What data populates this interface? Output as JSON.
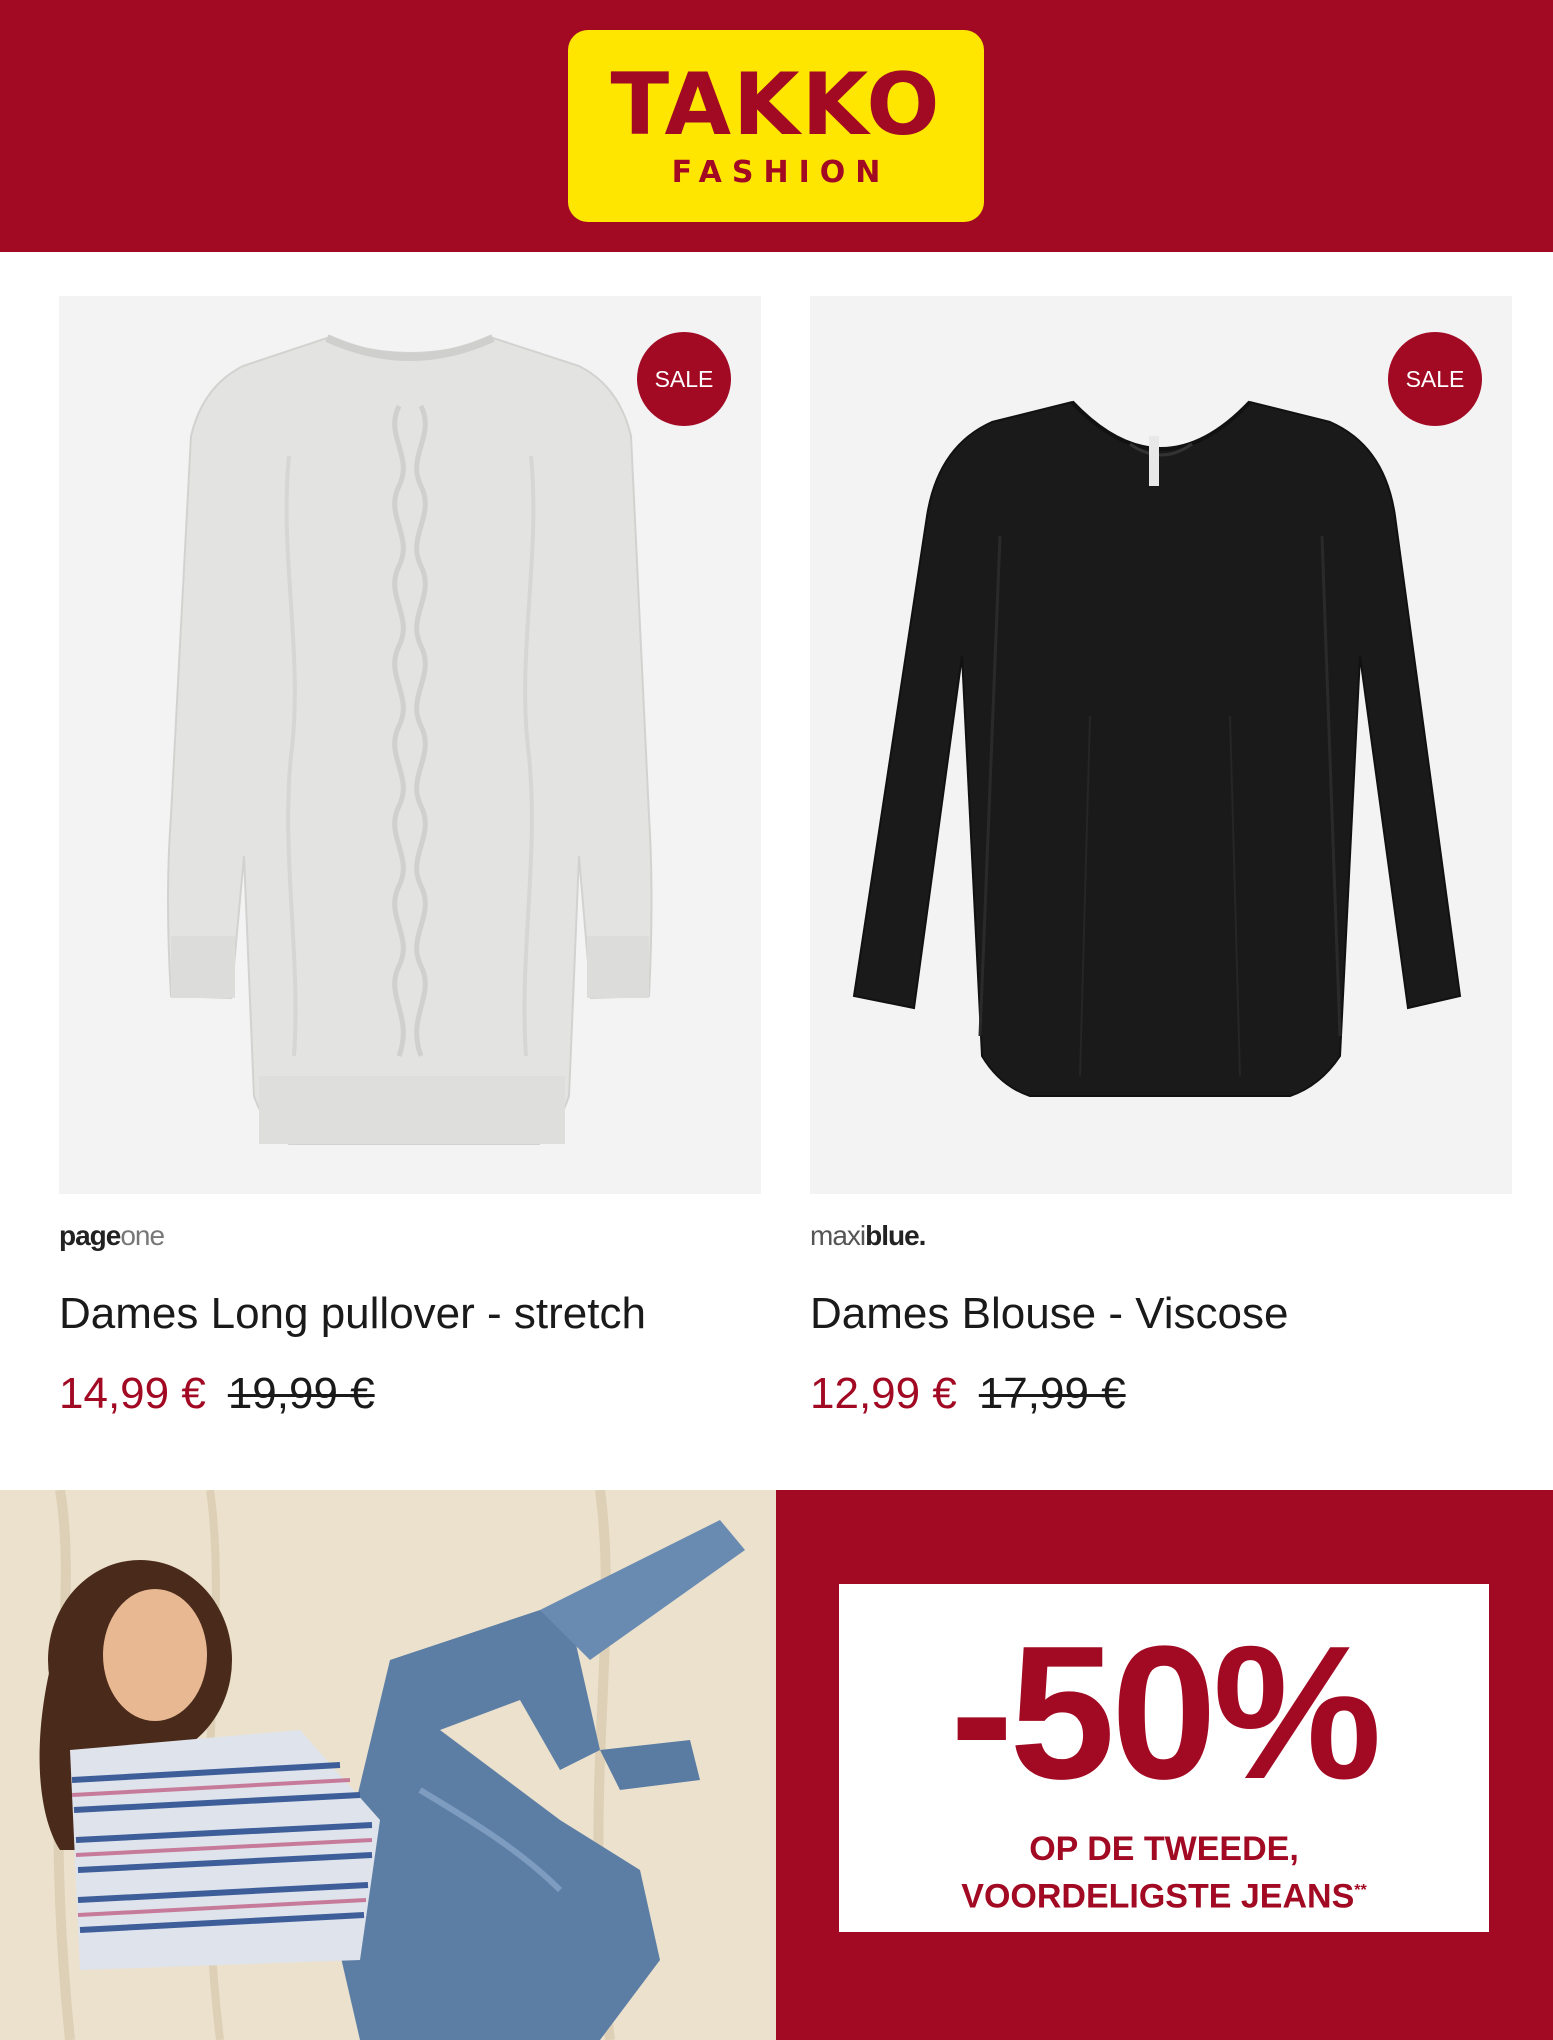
{
  "header": {
    "logo_word": "TAKKO",
    "logo_sub": "FASHION",
    "brand_color": "#a20a24",
    "logo_color": "#ffe600"
  },
  "products": [
    {
      "badge": "SALE",
      "brand_part1": "page",
      "brand_part2": "one",
      "title": "Dames Long pullover - stretch",
      "price_now": "14,99 €",
      "price_old": "19,99 €",
      "image": "grey-cable-knit-pullover"
    },
    {
      "badge": "SALE",
      "brand_part1": "maxi",
      "brand_part2": "blue.",
      "title": "Dames Blouse - Viscose",
      "price_now": "12,99 €",
      "price_old": "17,99 €",
      "image": "black-viscose-blouse"
    }
  ],
  "promo": {
    "percent": "-50%",
    "line1": "OP DE TWEEDE,",
    "line2": "VOORDELIGSTE JEANS",
    "footnote_mark": "**",
    "image": "woman-in-striped-top-and-jeans"
  }
}
